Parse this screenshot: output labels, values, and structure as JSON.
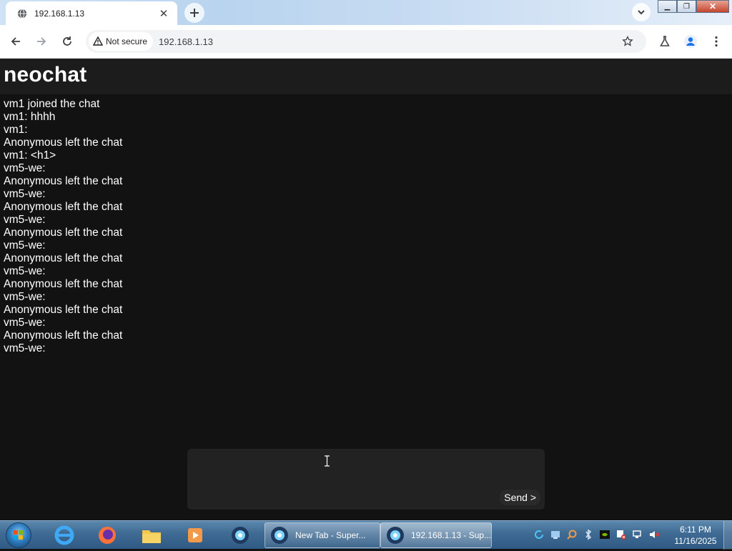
{
  "browser": {
    "tab": {
      "title": "192.168.1.13",
      "icon": "globe-icon"
    },
    "omnibox": {
      "security_label": "Not secure",
      "url": "192.168.1.13"
    }
  },
  "app": {
    "title": "neochat",
    "messages": [
      "vm1 joined the chat",
      "vm1: hhhh",
      "vm1:",
      "Anonymous left the chat",
      "vm1: <h1>",
      "vm5-we:",
      "Anonymous left the chat",
      "vm5-we:",
      "Anonymous left the chat",
      "vm5-we:",
      "Anonymous left the chat",
      "vm5-we:",
      "Anonymous left the chat",
      "vm5-we:",
      "Anonymous left the chat",
      "vm5-we:",
      "Anonymous left the chat",
      "vm5-we:",
      "Anonymous left the chat",
      "vm5-we:"
    ],
    "composer": {
      "value": "",
      "send_label": "Send >"
    },
    "colors": {
      "background": "#121212",
      "header": "#1c1c1c",
      "composer": "#222222",
      "text": "#ffffff"
    }
  },
  "taskbar": {
    "tasks": [
      {
        "label": "New Tab - Super..."
      },
      {
        "label": "192.168.1.13 - Sup..."
      }
    ],
    "clock": {
      "time": "6:11 PM",
      "date": "11/16/2025"
    }
  }
}
